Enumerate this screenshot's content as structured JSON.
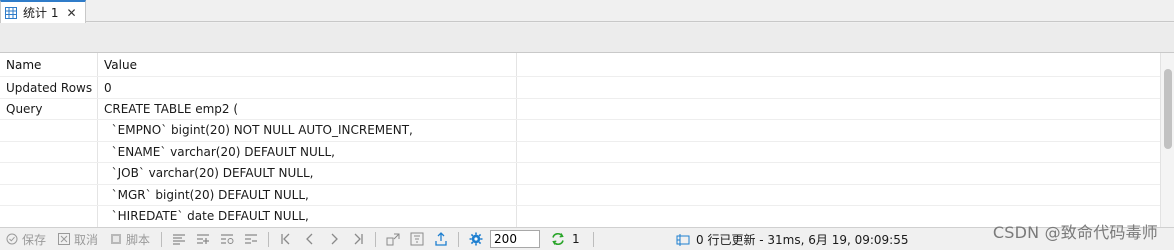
{
  "tab": {
    "label": "统计 1",
    "close": "✕"
  },
  "grid": {
    "headers": [
      "Name",
      "Value"
    ],
    "rows": [
      {
        "name": "Updated Rows",
        "value": "0"
      },
      {
        "name": "Query",
        "value": "CREATE TABLE emp2 ("
      },
      {
        "name": "",
        "value": "  `EMPNO` bigint(20) NOT NULL AUTO_INCREMENT,"
      },
      {
        "name": "",
        "value": "  `ENAME` varchar(20) DEFAULT NULL,"
      },
      {
        "name": "",
        "value": "  `JOB` varchar(20) DEFAULT NULL,"
      },
      {
        "name": "",
        "value": "  `MGR` bigint(20) DEFAULT NULL,"
      },
      {
        "name": "",
        "value": "  `HIREDATE` date DEFAULT NULL,"
      }
    ]
  },
  "toolbar": {
    "save": "保存",
    "cancel": "取消",
    "script": "脚本",
    "limit_value": "200",
    "refresh_count": "1",
    "status": "0 行已更新 - 31ms, 6月 19, 09:09:55"
  },
  "watermark": "CSDN @致命代码毒师",
  "colors": {
    "accent": "#2f7cc9",
    "gear": "#1e7fd0",
    "refresh": "#2aa52a",
    "disabled": "#9a9a9a"
  }
}
